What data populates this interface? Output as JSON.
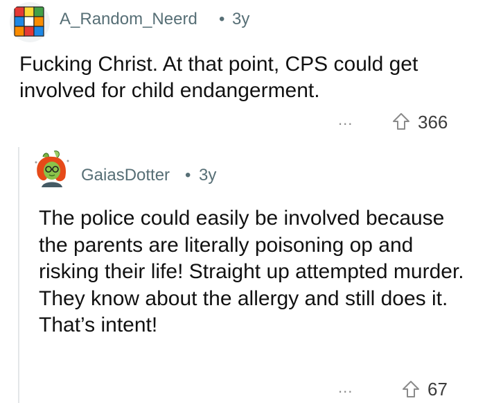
{
  "top_comment": {
    "username": "A_Random_Neerd",
    "separator": "•",
    "age": "3y",
    "body": "Fucking Christ. At that point, CPS could get involved for child endangerment.",
    "more_label": "...",
    "score": "366",
    "avatar_icon": "rubiks-cube-avatar-icon"
  },
  "reply": {
    "username": "GaiasDotter",
    "separator": "•",
    "age": "3y",
    "body": "The police could easily be involved because the parents are literally poisoning op and risking their life! Straight up attempted murder. They know about the allergy and still does it. That’s intent!",
    "more_label": "...",
    "score": "67",
    "avatar_icon": "red-haired-girl-avatar-icon"
  },
  "colors": {
    "meta_text": "#576f76",
    "body_text": "#111111",
    "thread_line": "#e3e6e8"
  }
}
